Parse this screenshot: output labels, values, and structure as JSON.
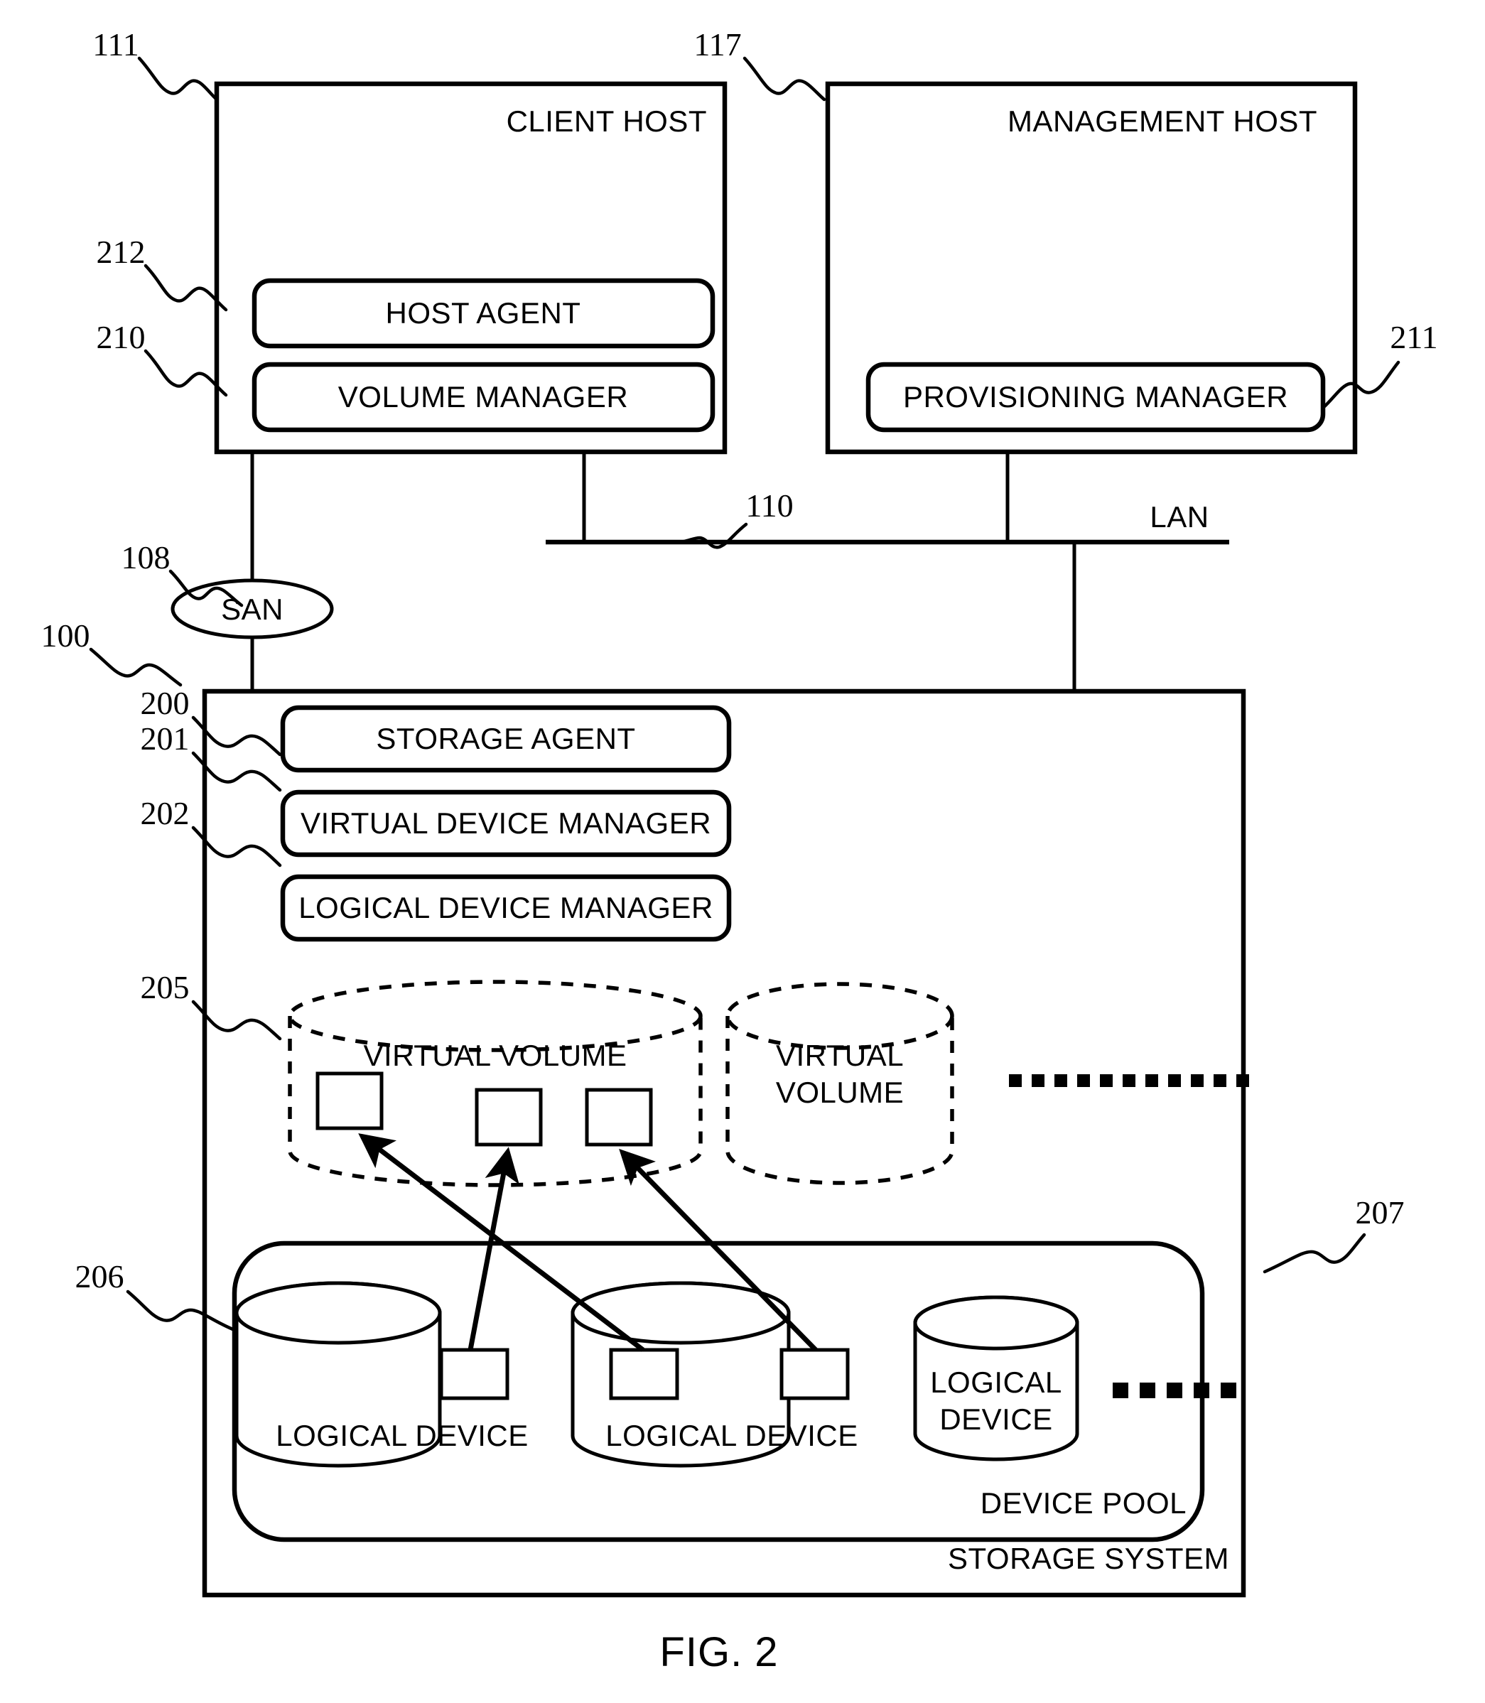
{
  "figure": {
    "caption": "FIG. 2"
  },
  "client_host": {
    "title": "CLIENT HOST",
    "ref": "111",
    "modules": [
      {
        "label": "HOST AGENT",
        "ref": "212"
      },
      {
        "label": "VOLUME MANAGER",
        "ref": "210"
      }
    ]
  },
  "management_host": {
    "title": "MANAGEMENT HOST",
    "ref": "117",
    "modules": [
      {
        "label": "PROVISIONING MANAGER",
        "ref": "211"
      }
    ]
  },
  "network": {
    "san": {
      "label": "SAN",
      "ref": "108"
    },
    "lan": {
      "label": "LAN",
      "ref": "110"
    }
  },
  "storage_system": {
    "title": "STORAGE SYSTEM",
    "ref": "100",
    "modules": [
      {
        "label": "STORAGE AGENT",
        "ref": "200"
      },
      {
        "label": "VIRTUAL DEVICE MANAGER",
        "ref": "201"
      },
      {
        "label": "LOGICAL DEVICE MANAGER",
        "ref": "202"
      }
    ],
    "virtual_volumes": {
      "ref": "205",
      "items": [
        {
          "label": "VIRTUAL VOLUME",
          "segments": 3
        },
        {
          "label_line1": "VIRTUAL",
          "label_line2": "VOLUME",
          "segments": 0
        }
      ],
      "ellipsis_dots": 11
    },
    "device_pool": {
      "title": "DEVICE POOL",
      "ref": "207",
      "logical_device_ref": "206",
      "items": [
        {
          "label": "LOGICAL DEVICE",
          "segments": 1
        },
        {
          "label": "LOGICAL DEVICE",
          "segments": 2
        },
        {
          "label_line1": "LOGICAL",
          "label_line2": "DEVICE",
          "segments": 0
        }
      ],
      "ellipsis_dots": 5
    }
  }
}
